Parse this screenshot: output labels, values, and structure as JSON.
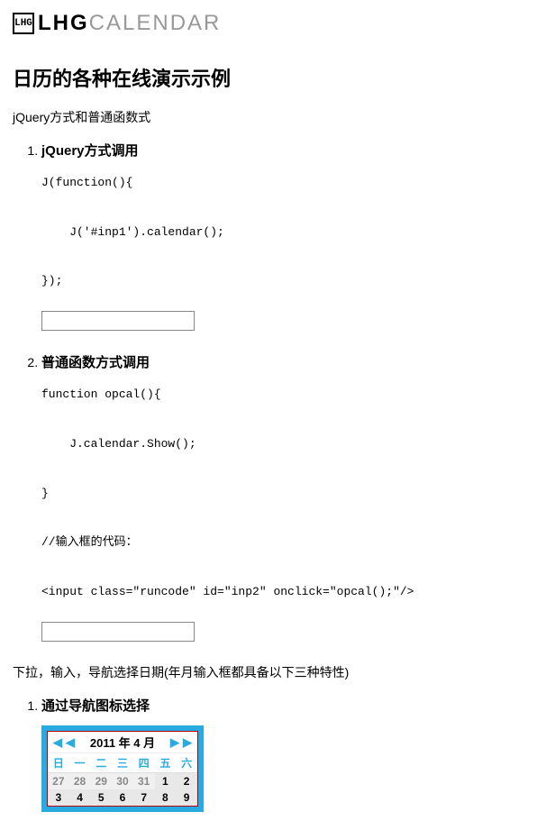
{
  "logo": {
    "icon_text": "LHG",
    "bold": "LHG",
    "light": "CALENDAR"
  },
  "title": "日历的各种在线演示示例",
  "section1_note": "jQuery方式和普通函数式",
  "list1": [
    {
      "head": "jQuery方式调用",
      "code": "J(function(){\n\n    J('#inp1').calendar();\n\n});"
    },
    {
      "head": "普通函数方式调用",
      "code": "function opcal(){\n\n    J.calendar.Show();\n\n}\n\n//输入框的代码：\n\n<input class=\"runcode\" id=\"inp2\" onclick=\"opcal();\"/>"
    }
  ],
  "section2_note": "下拉，输入，导航选择日期(年月输入框都具备以下三种特性)",
  "list2": [
    {
      "head": "通过导航图标选择"
    }
  ],
  "calendar": {
    "year_month": "2011 年 4 月",
    "weekdays": [
      "日",
      "一",
      "二",
      "三",
      "四",
      "五",
      "六"
    ],
    "rows": [
      [
        {
          "d": "27",
          "o": true
        },
        {
          "d": "28",
          "o": true
        },
        {
          "d": "29",
          "o": true
        },
        {
          "d": "30",
          "o": true
        },
        {
          "d": "31",
          "o": true
        },
        {
          "d": "1",
          "o": false
        },
        {
          "d": "2",
          "o": false
        }
      ],
      [
        {
          "d": "3",
          "o": false
        },
        {
          "d": "4",
          "o": false
        },
        {
          "d": "5",
          "o": false
        },
        {
          "d": "6",
          "o": false
        },
        {
          "d": "7",
          "o": false
        },
        {
          "d": "8",
          "o": false
        },
        {
          "d": "9",
          "o": false
        }
      ]
    ]
  }
}
